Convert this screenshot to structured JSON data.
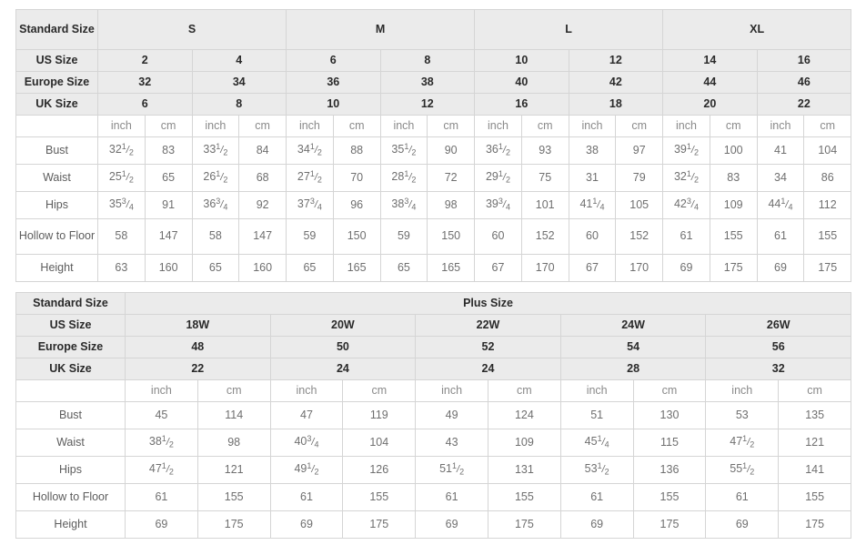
{
  "table1": {
    "label_col_header": "Standard Size",
    "groups": [
      {
        "label": "S",
        "span": 2
      },
      {
        "label": "M",
        "span": 2
      },
      {
        "label": "L",
        "span": 2
      },
      {
        "label": "XL",
        "span": 2
      }
    ],
    "size_rows": [
      {
        "label": "US Size",
        "values": [
          "2",
          "4",
          "6",
          "8",
          "10",
          "12",
          "14",
          "16"
        ]
      },
      {
        "label": "Europe Size",
        "values": [
          "32",
          "34",
          "36",
          "38",
          "40",
          "42",
          "44",
          "46"
        ]
      },
      {
        "label": "UK Size",
        "values": [
          "6",
          "8",
          "10",
          "12",
          "16",
          "18",
          "20",
          "22"
        ]
      }
    ],
    "unit_row": [
      "inch",
      "cm",
      "inch",
      "cm",
      "inch",
      "cm",
      "inch",
      "cm",
      "inch",
      "cm",
      "inch",
      "cm",
      "inch",
      "cm",
      "inch",
      "cm"
    ],
    "measure_rows": [
      {
        "label": "Bust",
        "values": [
          "32 1/2",
          "83",
          "33 1/2",
          "84",
          "34 1/2",
          "88",
          "35 1/2",
          "90",
          "36 1/2",
          "93",
          "38",
          "97",
          "39 1/2",
          "100",
          "41",
          "104"
        ]
      },
      {
        "label": "Waist",
        "values": [
          "25 1/2",
          "65",
          "26 1/2",
          "68",
          "27 1/2",
          "70",
          "28 1/2",
          "72",
          "29 1/2",
          "75",
          "31",
          "79",
          "32 1/2",
          "83",
          "34",
          "86"
        ]
      },
      {
        "label": "Hips",
        "values": [
          "35 3/4",
          "91",
          "36 3/4",
          "92",
          "37 3/4",
          "96",
          "38 3/4",
          "98",
          "39 3/4",
          "101",
          "41 1/4",
          "105",
          "42 3/4",
          "109",
          "44 1/4",
          "112"
        ]
      },
      {
        "label": "Hollow to Floor",
        "values": [
          "58",
          "147",
          "58",
          "147",
          "59",
          "150",
          "59",
          "150",
          "60",
          "152",
          "60",
          "152",
          "61",
          "155",
          "61",
          "155"
        ]
      },
      {
        "label": "Height",
        "values": [
          "63",
          "160",
          "65",
          "160",
          "65",
          "165",
          "65",
          "165",
          "67",
          "170",
          "67",
          "170",
          "69",
          "175",
          "69",
          "175"
        ]
      }
    ]
  },
  "table2": {
    "label_col_header": "Standard Size",
    "group_label": "Plus Size",
    "size_rows": [
      {
        "label": "US Size",
        "values": [
          "18W",
          "20W",
          "22W",
          "24W",
          "26W"
        ]
      },
      {
        "label": "Europe Size",
        "values": [
          "48",
          "50",
          "52",
          "54",
          "56"
        ]
      },
      {
        "label": "UK Size",
        "values": [
          "22",
          "24",
          "24",
          "28",
          "32"
        ]
      }
    ],
    "unit_row": [
      "inch",
      "cm",
      "inch",
      "cm",
      "inch",
      "cm",
      "inch",
      "cm",
      "inch",
      "cm"
    ],
    "measure_rows": [
      {
        "label": "Bust",
        "values": [
          "45",
          "114",
          "47",
          "119",
          "49",
          "124",
          "51",
          "130",
          "53",
          "135"
        ]
      },
      {
        "label": "Waist",
        "values": [
          "38 1/2",
          "98",
          "40 3/4",
          "104",
          "43",
          "109",
          "45 1/4",
          "115",
          "47 1/2",
          "121"
        ]
      },
      {
        "label": "Hips",
        "values": [
          "47 1/2",
          "121",
          "49 1/2",
          "126",
          "51 1/2",
          "131",
          "53 1/2",
          "136",
          "55 1/2",
          "141"
        ]
      },
      {
        "label": "Hollow to Floor",
        "values": [
          "61",
          "155",
          "61",
          "155",
          "61",
          "155",
          "61",
          "155",
          "61",
          "155"
        ]
      },
      {
        "label": "Height",
        "values": [
          "69",
          "175",
          "69",
          "175",
          "69",
          "175",
          "69",
          "175",
          "69",
          "175"
        ]
      }
    ]
  },
  "colors": {
    "header_bg": "#ebebeb",
    "cell_bg": "#ffffff",
    "border": "#d5d5d5",
    "header_text": "#2a2a2a",
    "body_text": "#6f6f6f"
  }
}
